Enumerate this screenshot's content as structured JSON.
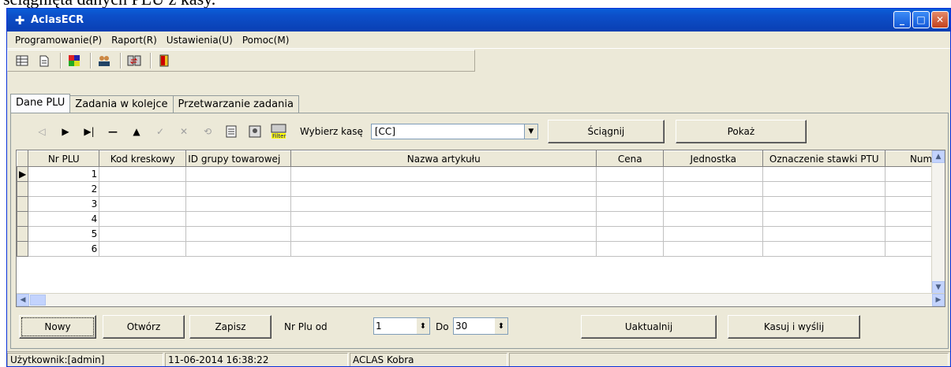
{
  "doc": {
    "text": "ściągnięta danych PLU z kasy."
  },
  "window": {
    "title": "AclasECR"
  },
  "menu": [
    "Programowanie(P)",
    "Raport(R)",
    "Ustawienia(U)",
    "Pomoc(M)"
  ],
  "tabs": [
    "Dane PLU",
    "Zadania w kolejce",
    "Przetwarzanie zadania"
  ],
  "nav": {
    "select_label": "Wybierz kasę",
    "selected": "[CC]",
    "download_label": "Ściągnij",
    "show_label": "Pokaż",
    "filter_label": "Filter"
  },
  "grid": {
    "columns": [
      "Nr PLU",
      "Kod kreskowy",
      "ID grupy towarowej",
      "Nazwa artykułu",
      "Cena",
      "Jednostka",
      "Oznaczenie stawki PTU",
      "Num"
    ],
    "rows": [
      "1",
      "2",
      "3",
      "4",
      "5",
      "6"
    ]
  },
  "bottom": {
    "new_label": "Nowy",
    "open_label": "Otwórz",
    "save_label": "Zapisz",
    "from_label": "Nr Plu od",
    "from_value": "1",
    "to_label": "Do",
    "to_value": "30",
    "update_label": "Uaktualnij",
    "delete_send_label": "Kasuj i wyślij"
  },
  "status": {
    "user": "Użytkownik:[admin]",
    "datetime": "11-06-2014 16:38:22",
    "device": "ACLAS Kobra"
  }
}
